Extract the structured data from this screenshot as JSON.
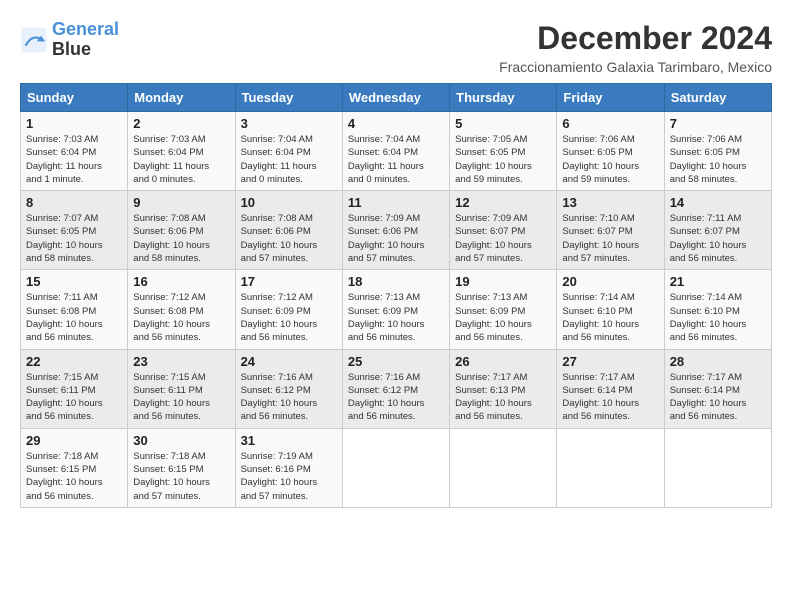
{
  "header": {
    "logo_line1": "General",
    "logo_line2": "Blue",
    "month": "December 2024",
    "location": "Fraccionamiento Galaxia Tarimbaro, Mexico"
  },
  "weekdays": [
    "Sunday",
    "Monday",
    "Tuesday",
    "Wednesday",
    "Thursday",
    "Friday",
    "Saturday"
  ],
  "weeks": [
    [
      {
        "day": "1",
        "info": "Sunrise: 7:03 AM\nSunset: 6:04 PM\nDaylight: 11 hours\nand 1 minute."
      },
      {
        "day": "2",
        "info": "Sunrise: 7:03 AM\nSunset: 6:04 PM\nDaylight: 11 hours\nand 0 minutes."
      },
      {
        "day": "3",
        "info": "Sunrise: 7:04 AM\nSunset: 6:04 PM\nDaylight: 11 hours\nand 0 minutes."
      },
      {
        "day": "4",
        "info": "Sunrise: 7:04 AM\nSunset: 6:04 PM\nDaylight: 11 hours\nand 0 minutes."
      },
      {
        "day": "5",
        "info": "Sunrise: 7:05 AM\nSunset: 6:05 PM\nDaylight: 10 hours\nand 59 minutes."
      },
      {
        "day": "6",
        "info": "Sunrise: 7:06 AM\nSunset: 6:05 PM\nDaylight: 10 hours\nand 59 minutes."
      },
      {
        "day": "7",
        "info": "Sunrise: 7:06 AM\nSunset: 6:05 PM\nDaylight: 10 hours\nand 58 minutes."
      }
    ],
    [
      {
        "day": "8",
        "info": "Sunrise: 7:07 AM\nSunset: 6:05 PM\nDaylight: 10 hours\nand 58 minutes."
      },
      {
        "day": "9",
        "info": "Sunrise: 7:08 AM\nSunset: 6:06 PM\nDaylight: 10 hours\nand 58 minutes."
      },
      {
        "day": "10",
        "info": "Sunrise: 7:08 AM\nSunset: 6:06 PM\nDaylight: 10 hours\nand 57 minutes."
      },
      {
        "day": "11",
        "info": "Sunrise: 7:09 AM\nSunset: 6:06 PM\nDaylight: 10 hours\nand 57 minutes."
      },
      {
        "day": "12",
        "info": "Sunrise: 7:09 AM\nSunset: 6:07 PM\nDaylight: 10 hours\nand 57 minutes."
      },
      {
        "day": "13",
        "info": "Sunrise: 7:10 AM\nSunset: 6:07 PM\nDaylight: 10 hours\nand 57 minutes."
      },
      {
        "day": "14",
        "info": "Sunrise: 7:11 AM\nSunset: 6:07 PM\nDaylight: 10 hours\nand 56 minutes."
      }
    ],
    [
      {
        "day": "15",
        "info": "Sunrise: 7:11 AM\nSunset: 6:08 PM\nDaylight: 10 hours\nand 56 minutes."
      },
      {
        "day": "16",
        "info": "Sunrise: 7:12 AM\nSunset: 6:08 PM\nDaylight: 10 hours\nand 56 minutes."
      },
      {
        "day": "17",
        "info": "Sunrise: 7:12 AM\nSunset: 6:09 PM\nDaylight: 10 hours\nand 56 minutes."
      },
      {
        "day": "18",
        "info": "Sunrise: 7:13 AM\nSunset: 6:09 PM\nDaylight: 10 hours\nand 56 minutes."
      },
      {
        "day": "19",
        "info": "Sunrise: 7:13 AM\nSunset: 6:09 PM\nDaylight: 10 hours\nand 56 minutes."
      },
      {
        "day": "20",
        "info": "Sunrise: 7:14 AM\nSunset: 6:10 PM\nDaylight: 10 hours\nand 56 minutes."
      },
      {
        "day": "21",
        "info": "Sunrise: 7:14 AM\nSunset: 6:10 PM\nDaylight: 10 hours\nand 56 minutes."
      }
    ],
    [
      {
        "day": "22",
        "info": "Sunrise: 7:15 AM\nSunset: 6:11 PM\nDaylight: 10 hours\nand 56 minutes."
      },
      {
        "day": "23",
        "info": "Sunrise: 7:15 AM\nSunset: 6:11 PM\nDaylight: 10 hours\nand 56 minutes."
      },
      {
        "day": "24",
        "info": "Sunrise: 7:16 AM\nSunset: 6:12 PM\nDaylight: 10 hours\nand 56 minutes."
      },
      {
        "day": "25",
        "info": "Sunrise: 7:16 AM\nSunset: 6:12 PM\nDaylight: 10 hours\nand 56 minutes."
      },
      {
        "day": "26",
        "info": "Sunrise: 7:17 AM\nSunset: 6:13 PM\nDaylight: 10 hours\nand 56 minutes."
      },
      {
        "day": "27",
        "info": "Sunrise: 7:17 AM\nSunset: 6:14 PM\nDaylight: 10 hours\nand 56 minutes."
      },
      {
        "day": "28",
        "info": "Sunrise: 7:17 AM\nSunset: 6:14 PM\nDaylight: 10 hours\nand 56 minutes."
      }
    ],
    [
      {
        "day": "29",
        "info": "Sunrise: 7:18 AM\nSunset: 6:15 PM\nDaylight: 10 hours\nand 56 minutes."
      },
      {
        "day": "30",
        "info": "Sunrise: 7:18 AM\nSunset: 6:15 PM\nDaylight: 10 hours\nand 57 minutes."
      },
      {
        "day": "31",
        "info": "Sunrise: 7:19 AM\nSunset: 6:16 PM\nDaylight: 10 hours\nand 57 minutes."
      },
      null,
      null,
      null,
      null
    ]
  ]
}
